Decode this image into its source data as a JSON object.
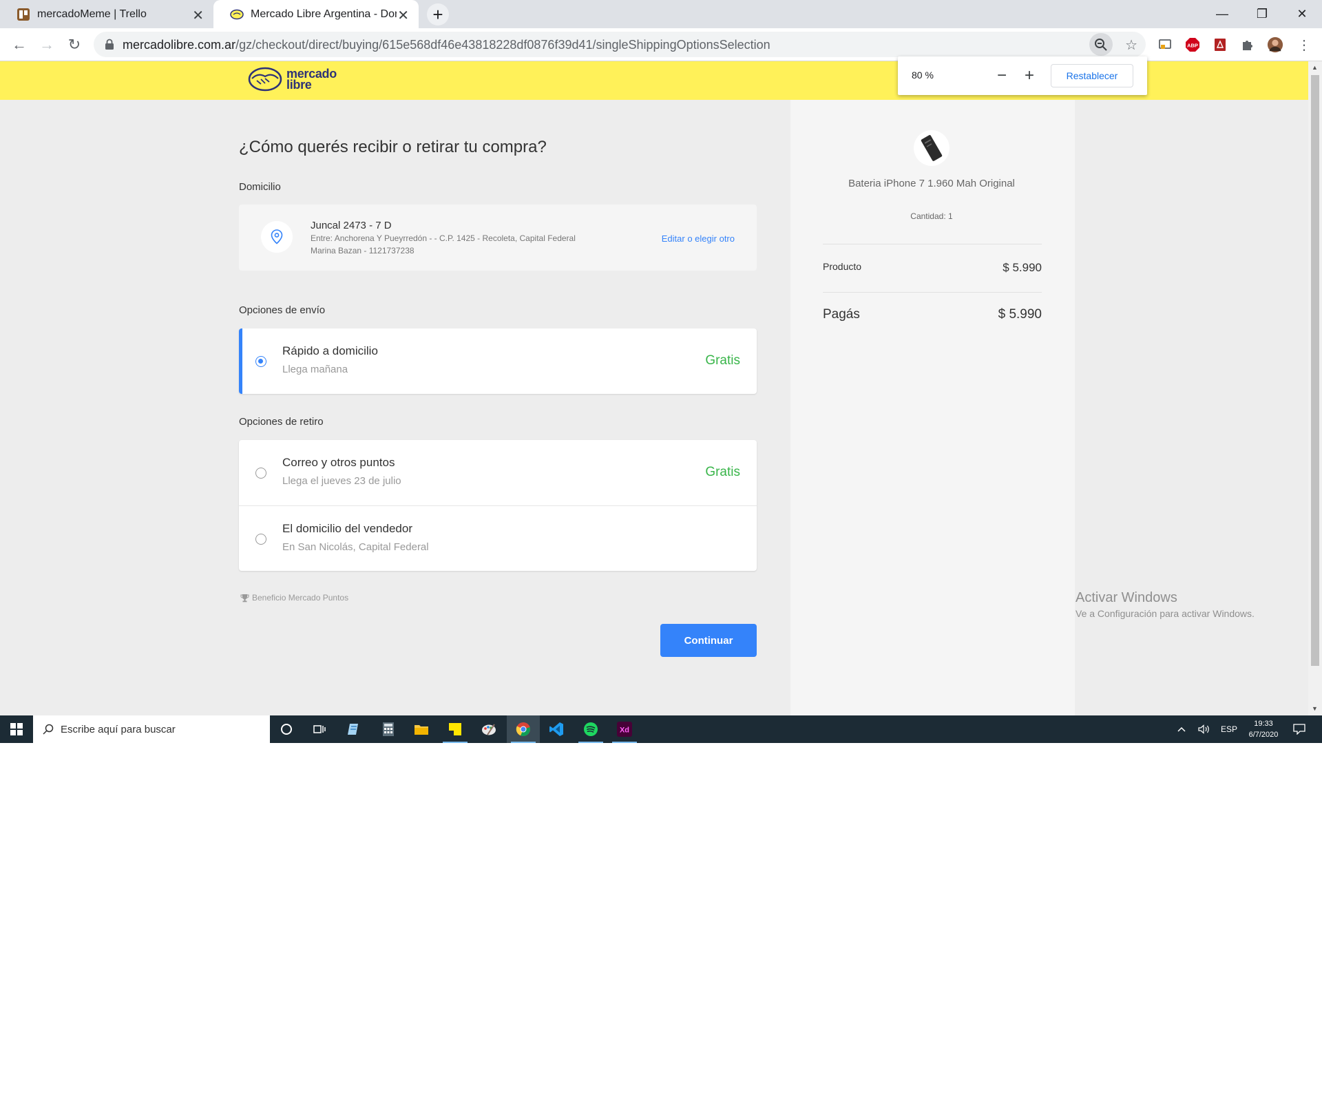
{
  "browser": {
    "tabs": [
      {
        "title": "mercadoMeme | Trello",
        "active": false
      },
      {
        "title": "Mercado Libre Argentina - Dond",
        "active": true
      }
    ],
    "url_host": "mercadolibre.com.ar",
    "url_path": "/gz/checkout/direct/buying/615e568df46e43818228df0876f39d41/singleShippingOptionsSelection",
    "zoom_popup": {
      "value": "80 %",
      "reset_label": "Restablecer"
    }
  },
  "header": {
    "logo_line1": "mercado",
    "logo_line2": "libre"
  },
  "checkout": {
    "title": "¿Cómo querés recibir o retirar tu compra?",
    "address_section_label": "Domicilio",
    "address": {
      "street": "Juncal 2473 - 7 D",
      "between": "Entre: Anchorena Y Pueyrredón - - C.P. 1425 - Recoleta, Capital Federal",
      "contact": "Marina Bazan - 1121737238",
      "edit_label": "Editar o elegir otro"
    },
    "shipping_label": "Opciones de envío",
    "shipping_options": [
      {
        "title": "Rápido a domicilio",
        "subtitle": "Llega mañana",
        "price": "Gratis",
        "selected": true
      }
    ],
    "pickup_label": "Opciones de retiro",
    "pickup_options": [
      {
        "title": "Correo y otros puntos",
        "subtitle": "Llega el jueves 23 de julio",
        "price": "Gratis",
        "selected": false
      },
      {
        "title": "El domicilio del vendedor",
        "subtitle": "En San Nicolás, Capital Federal",
        "price": "",
        "selected": false
      }
    ],
    "benefit": "Beneficio Mercado Puntos",
    "continue_label": "Continuar"
  },
  "summary": {
    "product_name": "Bateria iPhone 7 1.960 Mah Original",
    "quantity": "Cantidad: 1",
    "product_label": "Producto",
    "product_price": "$ 5.990",
    "total_label": "Pagás",
    "total_price": "$ 5.990"
  },
  "watermark": {
    "line1": "Activar Windows",
    "line2": "Ve a Configuración para activar Windows."
  },
  "taskbar": {
    "search_placeholder": "Escribe aquí para buscar",
    "language": "ESP",
    "time": "19:33",
    "date": "6/7/2020"
  },
  "colors": {
    "accent": "#3483fa",
    "header": "#fff159",
    "free": "#39b54a",
    "taskbar": "#1c2b35"
  }
}
